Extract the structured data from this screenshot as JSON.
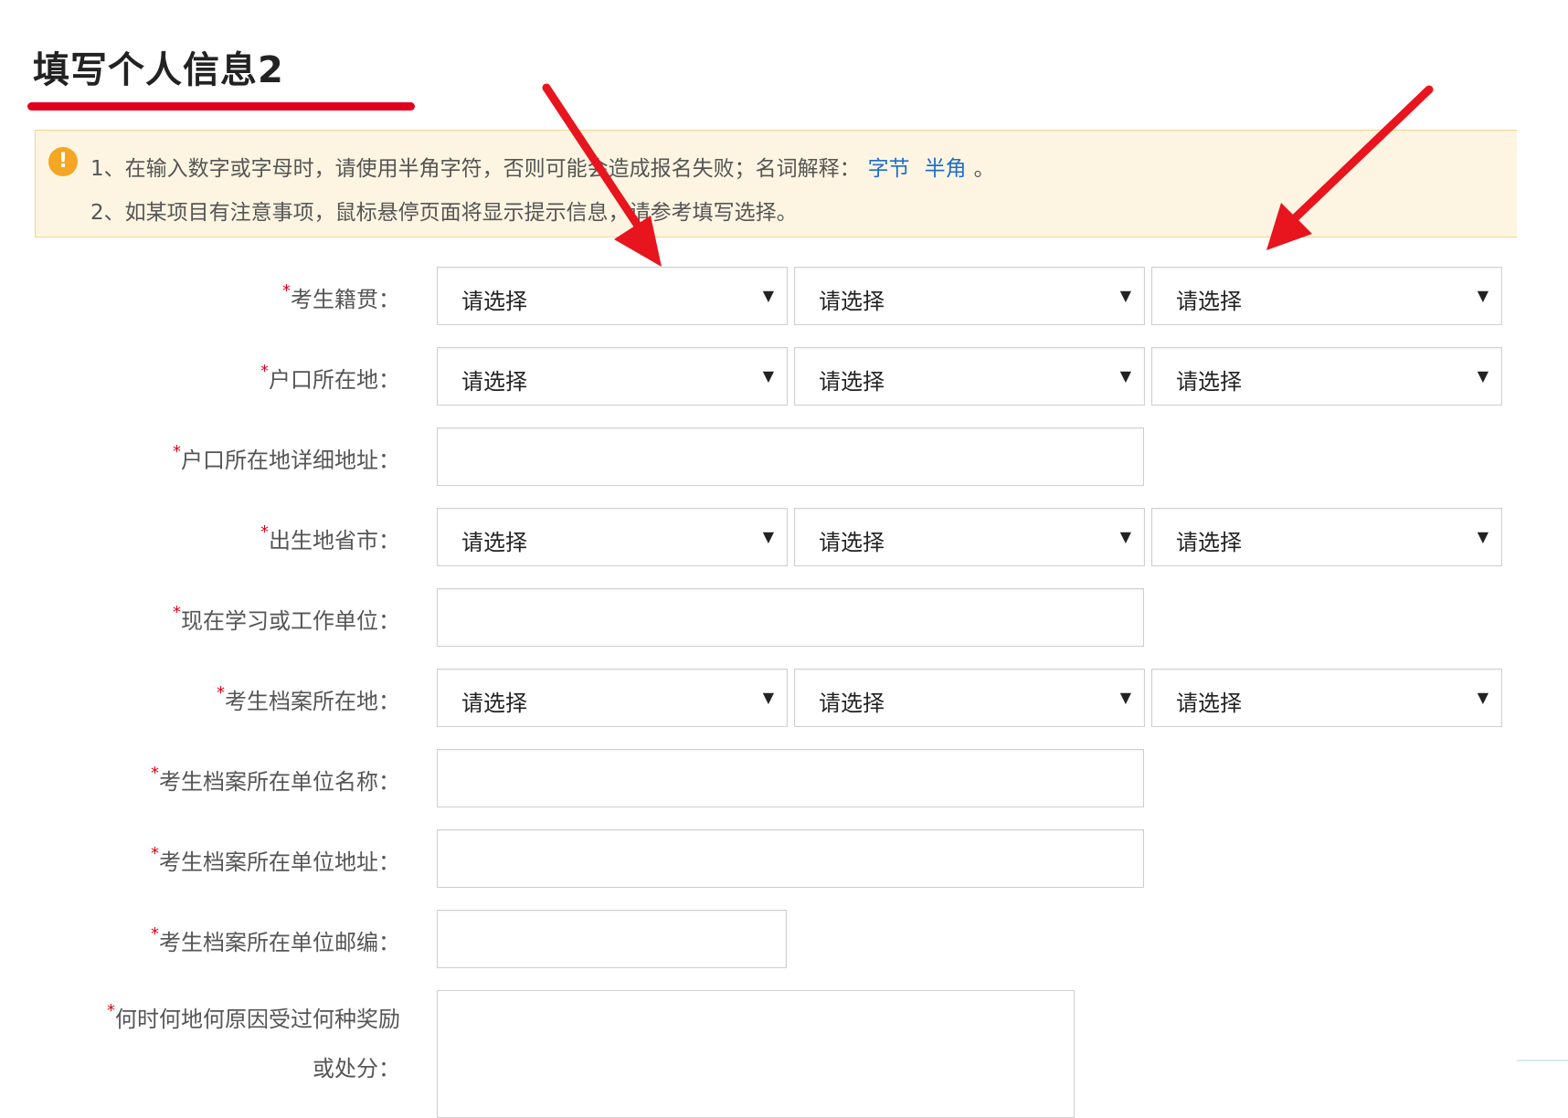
{
  "page": {
    "title": "填写个人信息2"
  },
  "notice": {
    "line1_text": "1、在输入数字或字母时，请使用半角字符，否则可能会造成报名失败；名词解释：",
    "link1": "字节",
    "link2": "半角",
    "line1_end": "。",
    "line2_text": "2、如某项目有注意事项，鼠标悬停页面将显示提示信息，请参考填写选择。"
  },
  "select_placeholder": "请选择",
  "fields": {
    "native_place": {
      "label": "考生籍贯：",
      "values": [
        "请选择",
        "请选择",
        "请选择"
      ]
    },
    "household_location": {
      "label": "户口所在地：",
      "values": [
        "请选择",
        "请选择",
        "请选择"
      ]
    },
    "household_address": {
      "label": "户口所在地详细地址：",
      "value": ""
    },
    "birthplace": {
      "label": "出生地省市：",
      "values": [
        "请选择",
        "请选择",
        "请选择"
      ]
    },
    "current_unit": {
      "label": "现在学习或工作单位：",
      "value": ""
    },
    "archive_location": {
      "label": "考生档案所在地：",
      "values": [
        "请选择",
        "请选择",
        "请选择"
      ]
    },
    "archive_unit_name": {
      "label": "考生档案所在单位名称：",
      "value": ""
    },
    "archive_unit_address": {
      "label": "考生档案所在单位地址：",
      "value": ""
    },
    "archive_unit_postcode": {
      "label": "考生档案所在单位邮编：",
      "value": ""
    },
    "rewards_punishments": {
      "label_line1": "何时何地何原因受过何种奖励",
      "label_line2": "或处分：",
      "value": ""
    }
  },
  "required_mark": "*",
  "colors": {
    "accent_red": "#e0001b",
    "notice_bg": "#fdf5e2",
    "link_blue": "#1e6fc9"
  },
  "icons": {
    "notice": "warning-icon",
    "dropdown": "caret-down-icon"
  }
}
